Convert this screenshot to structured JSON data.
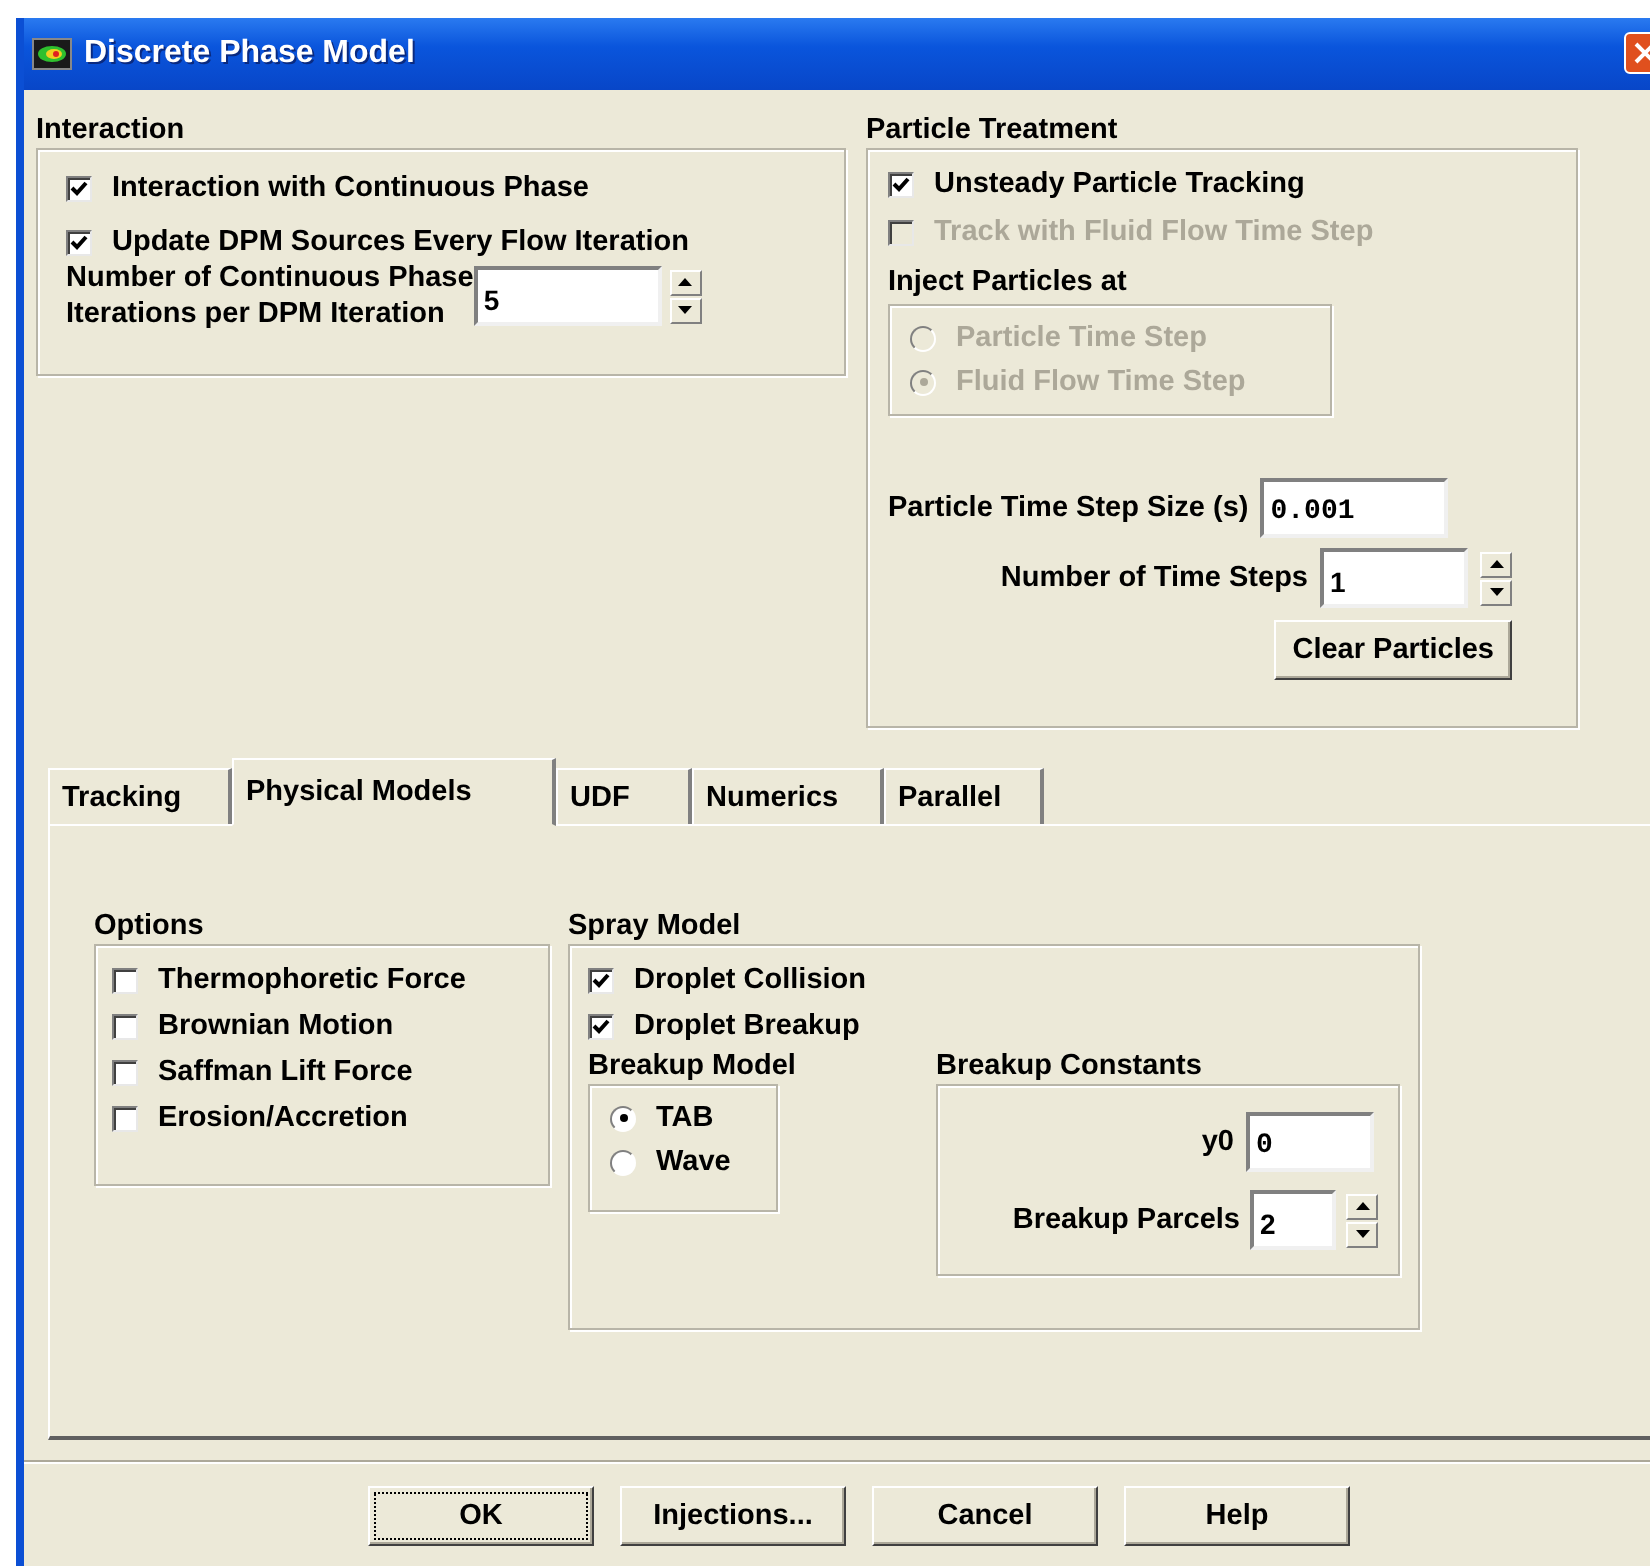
{
  "window": {
    "title": "Discrete Phase Model"
  },
  "interaction": {
    "title": "Interaction",
    "checkboxes": [
      {
        "label": "Interaction with Continuous Phase",
        "checked": true
      },
      {
        "label": "Update DPM Sources Every Flow Iteration",
        "checked": true
      }
    ],
    "spinner": {
      "label_lines": [
        "Number of Continuous Phase",
        "Iterations per DPM Iteration"
      ],
      "value": "5"
    }
  },
  "particle_treatment": {
    "title": "Particle Treatment",
    "checkboxes": [
      {
        "label": "Unsteady Particle Tracking",
        "checked": true,
        "disabled": false
      },
      {
        "label": "Track with Fluid Flow Time Step",
        "checked": false,
        "disabled": true
      }
    ],
    "inject": {
      "title": "Inject Particles at",
      "radios": [
        {
          "label": "Particle Time Step",
          "selected": false,
          "disabled": true
        },
        {
          "label": "Fluid Flow Time Step",
          "selected": true,
          "disabled": true
        }
      ]
    },
    "step_size": {
      "label": "Particle Time Step Size (s)",
      "value": "0.001",
      "kind": "real"
    },
    "time_steps": {
      "label": "Number of Time Steps",
      "value": "1",
      "kind": "integer"
    },
    "clear_button": "Clear Particles"
  },
  "tabs": [
    {
      "label": "Tracking",
      "selected": false
    },
    {
      "label": "Physical Models",
      "selected": true
    },
    {
      "label": "UDF",
      "selected": false
    },
    {
      "label": "Numerics",
      "selected": false
    },
    {
      "label": "Parallel",
      "selected": false
    }
  ],
  "options": {
    "title": "Options",
    "checkboxes": [
      {
        "label": "Thermophoretic Force",
        "checked": false
      },
      {
        "label": "Brownian Motion",
        "checked": false
      },
      {
        "label": "Saffman Lift Force",
        "checked": false
      },
      {
        "label": "Erosion/Accretion",
        "checked": false
      }
    ]
  },
  "spray_model": {
    "title": "Spray Model",
    "checkboxes": [
      {
        "label": "Droplet Collision",
        "checked": true
      },
      {
        "label": "Droplet Breakup",
        "checked": true
      }
    ],
    "breakup_model": {
      "title": "Breakup Model",
      "radios": [
        {
          "label": "TAB",
          "selected": true,
          "disabled": false
        },
        {
          "label": "Wave",
          "selected": false,
          "disabled": false
        }
      ]
    },
    "breakup_constants": {
      "title": "Breakup Constants",
      "y0": {
        "label": "y0",
        "value": "0",
        "kind": "real"
      },
      "parcels": {
        "label": "Breakup Parcels",
        "value": "2",
        "kind": "integer"
      }
    }
  },
  "buttons": [
    {
      "label": "OK",
      "default": true
    },
    {
      "label": "Injections...",
      "default": false
    },
    {
      "label": "Cancel",
      "default": false
    },
    {
      "label": "Help",
      "default": false
    }
  ]
}
